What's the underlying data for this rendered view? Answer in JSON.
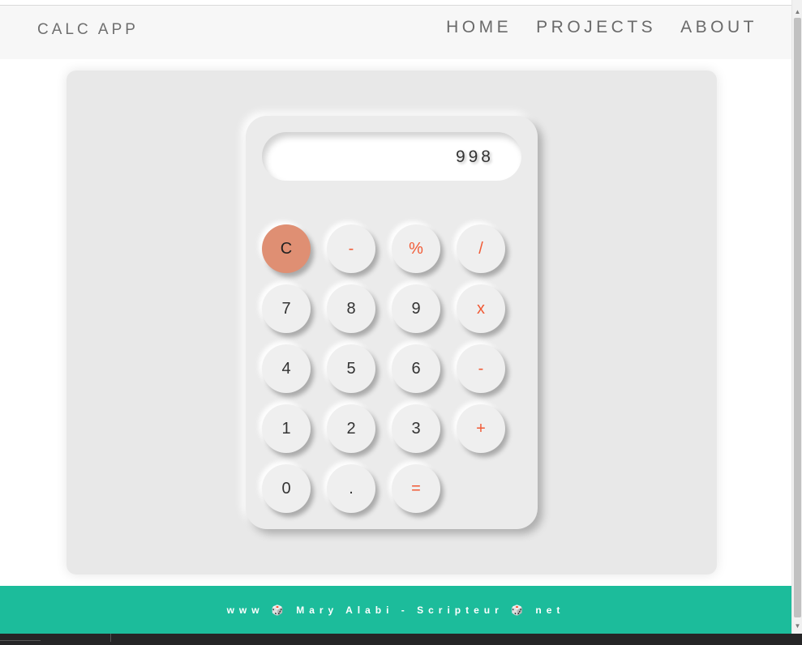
{
  "navbar": {
    "brand": "CALC APP",
    "links": [
      "HOME",
      "PROJECTS",
      "ABOUT"
    ]
  },
  "calculator": {
    "display": "998",
    "keys": [
      {
        "label": "C",
        "type": "clear"
      },
      {
        "label": "-",
        "type": "op"
      },
      {
        "label": "%",
        "type": "op"
      },
      {
        "label": "/",
        "type": "op"
      },
      {
        "label": "7",
        "type": "digit"
      },
      {
        "label": "8",
        "type": "digit"
      },
      {
        "label": "9",
        "type": "digit"
      },
      {
        "label": "x",
        "type": "op"
      },
      {
        "label": "4",
        "type": "digit"
      },
      {
        "label": "5",
        "type": "digit"
      },
      {
        "label": "6",
        "type": "digit"
      },
      {
        "label": "-",
        "type": "op"
      },
      {
        "label": "1",
        "type": "digit"
      },
      {
        "label": "2",
        "type": "digit"
      },
      {
        "label": "3",
        "type": "digit"
      },
      {
        "label": "+",
        "type": "op"
      },
      {
        "label": "0",
        "type": "digit"
      },
      {
        "label": ".",
        "type": "digit"
      },
      {
        "label": "=",
        "type": "op"
      }
    ]
  },
  "footer": {
    "text": "www 🎲 Mary Alabi - Scripteur 🎲 net"
  },
  "colors": {
    "footer_bg": "#1cbc9b",
    "operator": "#f15a35",
    "clear_key": "#df8f73"
  },
  "icons": {
    "scroll_up": "up-arrow-icon",
    "scroll_down": "down-arrow-icon"
  }
}
